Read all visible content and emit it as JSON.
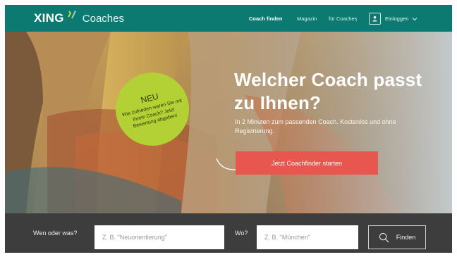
{
  "header": {
    "logo_word": "XING",
    "logo_sub": "Coaches",
    "nav": [
      {
        "label": "Coach finden",
        "active": true
      },
      {
        "label": "Magazin",
        "active": false
      },
      {
        "label": "für Coaches",
        "active": false
      }
    ],
    "login_label": "Einloggen"
  },
  "badge": {
    "title": "NEU",
    "text": "Wie zufrieden waren Sie mit Ihrem Coach? Jetzt Bewertung abgeben!"
  },
  "hero": {
    "title": "Welcher Coach passt zu Ihnen?",
    "text": "In 2 Minuten zum passenden Coach. Kostenlos und ohne Registrierung.",
    "cta_label": "Jetzt Coachfinder starten"
  },
  "search": {
    "what_label": "Wen oder was?",
    "what_placeholder": "Z. B. \"Neuorientierung\"",
    "where_label": "Wo?",
    "where_placeholder": "Z. B. \"München\"",
    "find_label": "Finden"
  },
  "colors": {
    "header_bg": "#0c7a70",
    "cta_bg": "#e8574f",
    "badge_bg": "#b3d034",
    "search_bg": "#3d3d3d"
  },
  "icons": [
    "xing-logo-icon",
    "user-icon",
    "chevron-down-icon",
    "curved-arrow-icon",
    "search-icon"
  ]
}
